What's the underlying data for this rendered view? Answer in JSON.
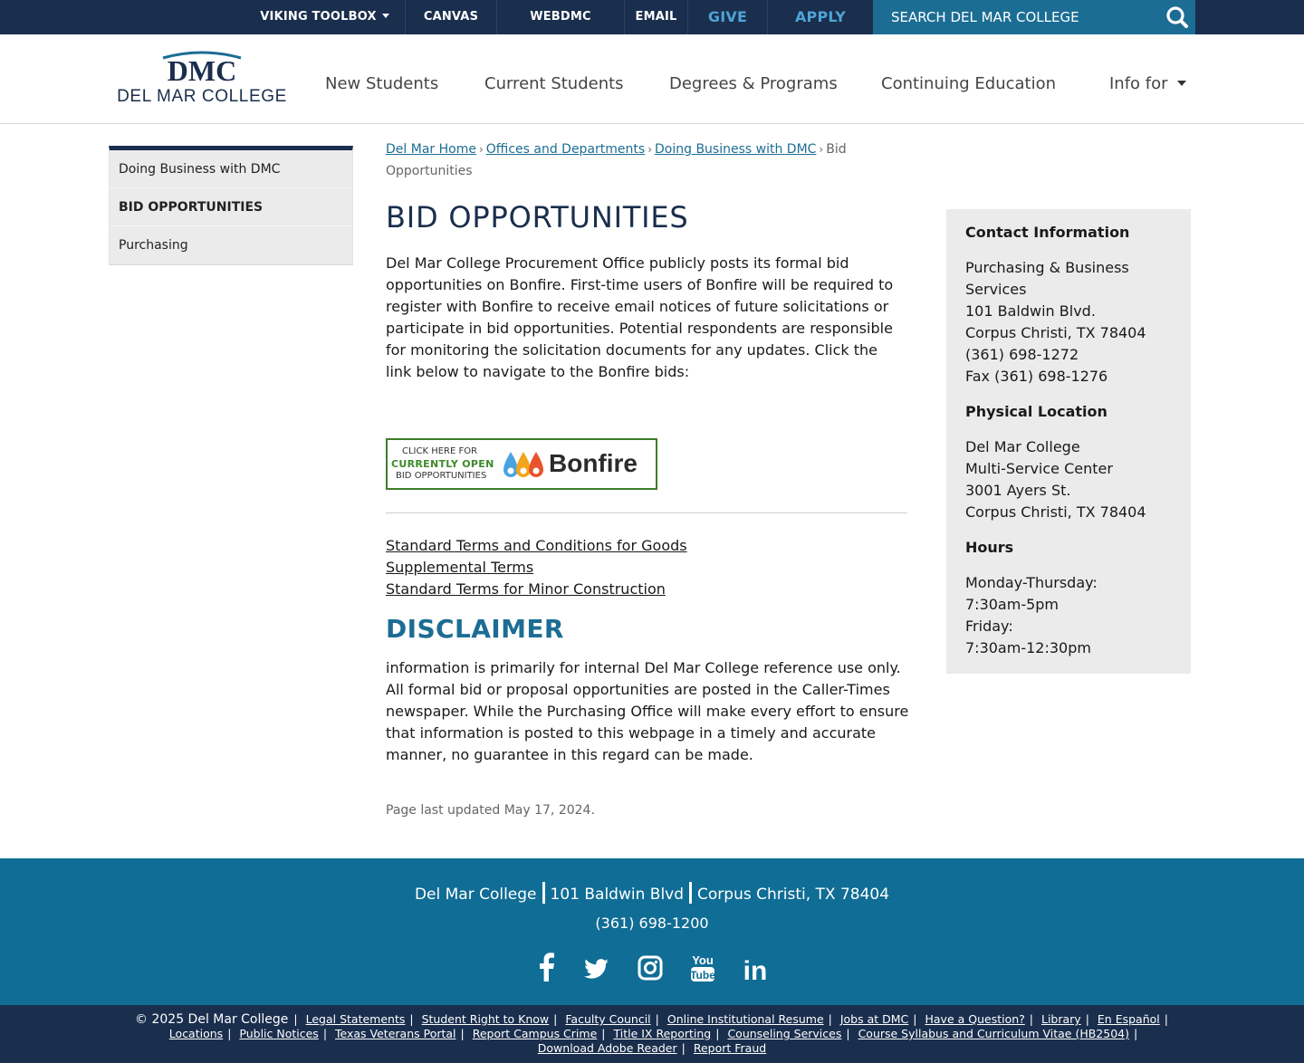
{
  "topbar": {
    "items": [
      "VIKING TOOLBOX",
      "CANVAS",
      "WEBDMC",
      "EMAIL",
      "GIVE",
      "APPLY"
    ],
    "search_placeholder": "SEARCH DEL MAR COLLEGE",
    "icon": "search-icon"
  },
  "header": {
    "logo_mark": "DMC",
    "logo_text": "DEL MAR COLLEGE",
    "nav": [
      "New Students",
      "Current Students",
      "Degrees & Programs",
      "Continuing Education",
      "Info for"
    ]
  },
  "sidebar": {
    "items": [
      "Doing Business with DMC",
      "BID OPPORTUNITIES",
      "Purchasing"
    ]
  },
  "breadcrumb": {
    "links": [
      "Del Mar Home",
      "Offices and Departments",
      "Doing Business with DMC"
    ],
    "current": "Bid Opportunities"
  },
  "main": {
    "title": "BID OPPORTUNITIES",
    "intro": "Del Mar College Procurement Office publicly posts its formal bid opportunities on Bonfire. First-time users of Bonfire will be required to register with Bonfire to receive email notices of future solicitations or participate in bid opportunities. Potential respondents are responsible for monitoring the solicitation documents for any updates. Click the link below to navigate to the Bonfire bids:",
    "bonfire": {
      "line1": "CLICK HERE FOR",
      "line2": "CURRENTLY OPEN",
      "line3": "BID OPPORTUNITIES",
      "brand": "Bonfire"
    },
    "terms": [
      "Standard Terms and Conditions for Goods",
      "Supplemental Terms",
      "Standard Terms for Minor Construction"
    ],
    "disclaimer_title": "DISCLAIMER",
    "disclaimer_text": "information is primarily for internal Del Mar College reference use only. All formal bid or proposal opportunities are posted in the Caller-Times newspaper. While the Purchasing Office will make every effort to ensure that information is posted to this webpage in a timely and accurate manner, no guarantee in this regard can be made.",
    "updated": "Page last updated May 17, 2024."
  },
  "contact": {
    "heading": "Contact Information",
    "office": [
      "Purchasing & Business Services",
      "101 Baldwin Blvd.",
      "Corpus Christi, TX 78404",
      "(361) 698-1272",
      "Fax (361) 698-1276"
    ],
    "location_heading": "Physical Location",
    "location": [
      "Del Mar College",
      "Multi-Service Center",
      "3001 Ayers St.",
      "Corpus Christi, TX 78404"
    ],
    "hours_heading": "Hours",
    "hours": [
      "Monday-Thursday:",
      "7:30am-5pm",
      "Friday:",
      "7:30am-12:30pm"
    ]
  },
  "footer": {
    "address": [
      "Del Mar College",
      "101 Baldwin Blvd",
      "Corpus Christi, TX 78404"
    ],
    "phone": "(361) 698-1200",
    "social_icons": [
      "facebook-icon",
      "twitter-icon",
      "instagram-icon",
      "youtube-icon",
      "linkedin-icon"
    ],
    "youtube_text": [
      "You",
      "Tube"
    ],
    "linkedin_text": "in",
    "copyright": "© 2025 Del Mar College",
    "links_line1": [
      "Legal Statements",
      "Student Right to Know",
      "Faculty Council",
      "Online Institutional Resume",
      "Jobs at DMC",
      "Have a Question?",
      "Library",
      "En Español"
    ],
    "links_line2": [
      "Locations",
      "Public Notices",
      "Texas Veterans Portal",
      "Report Campus Crime",
      "Title IX Reporting",
      "Counseling Services",
      "Course Syllabus and Curriculum Vitae (HB2504)"
    ],
    "links_line3": [
      "Download Adobe Reader",
      "Report Fraud"
    ]
  },
  "colors": {
    "navy": "#1a2e4d",
    "teal": "#1c6d94",
    "footer_teal": "#106d95",
    "accent_blue": "#4da4d6",
    "panel_gray": "#ebebeb",
    "bonfire_green": "#3d7d2a"
  }
}
